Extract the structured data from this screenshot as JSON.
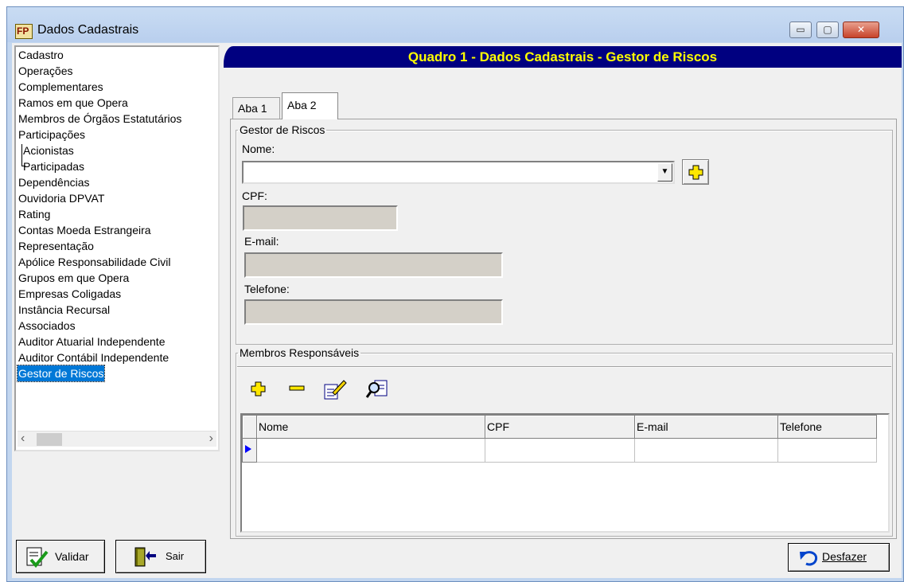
{
  "window": {
    "title": "Dados Cadastrais",
    "app_icon_text": "FP",
    "min_symbol": "▭",
    "max_symbol": "▢",
    "close_symbol": "✕"
  },
  "sidebar": {
    "items": [
      {
        "label": "Cadastro"
      },
      {
        "label": "Operações"
      },
      {
        "label": "Complementares"
      },
      {
        "label": "Ramos em que Opera"
      },
      {
        "label": "Membros de Órgãos Estatutários"
      },
      {
        "label": "Participações"
      },
      {
        "label": "Acionistas"
      },
      {
        "label": "Participadas"
      },
      {
        "label": "Dependências"
      },
      {
        "label": "Ouvidoria DPVAT"
      },
      {
        "label": "Rating"
      },
      {
        "label": "Contas Moeda Estrangeira"
      },
      {
        "label": "Representação"
      },
      {
        "label": "Apólice Responsabilidade Civil"
      },
      {
        "label": "Grupos em que Opera"
      },
      {
        "label": "Empresas Coligadas"
      },
      {
        "label": "Instância Recursal"
      },
      {
        "label": "Associados"
      },
      {
        "label": "Auditor Atuarial Independente"
      },
      {
        "label": "Auditor Contábil Independente"
      },
      {
        "label": "Gestor de Riscos"
      }
    ],
    "selected": "Gestor de Riscos"
  },
  "buttons": {
    "validar": "Validar",
    "sair": "Sair",
    "desfazer": "Desfazer"
  },
  "header": {
    "title": "Quadro 1 - Dados Cadastrais - Gestor de Riscos"
  },
  "tabs": [
    {
      "label": "Aba 1",
      "active": false
    },
    {
      "label": "Aba 2",
      "active": true
    }
  ],
  "gestor": {
    "legend": "Gestor de Riscos",
    "nome_label": "Nome:",
    "nome_value": "",
    "cpf_label": "CPF:",
    "cpf_value": "",
    "email_label": "E-mail:",
    "email_value": "",
    "telefone_label": "Telefone:",
    "telefone_value": ""
  },
  "membros": {
    "legend": "Membros Responsáveis",
    "columns": [
      "Nome",
      "CPF",
      "E-mail",
      "Telefone"
    ],
    "rows": [
      [
        "",
        "",
        "",
        ""
      ]
    ]
  },
  "icons": {
    "add": "add-icon",
    "remove": "remove-icon",
    "edit": "edit-icon",
    "search": "search-icon"
  },
  "colors": {
    "header_bg": "#000080",
    "header_text": "#ffff00",
    "selection": "#0078d7"
  }
}
